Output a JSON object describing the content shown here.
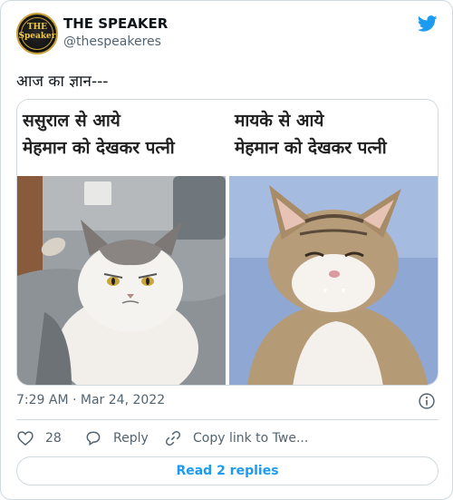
{
  "author": {
    "avatar_text_line1": "THE",
    "avatar_text_line2": "Speaker",
    "name": "THE SPEAKER",
    "handle": "@thespeakeres"
  },
  "tweet": {
    "text": "आज का ज्ञान---",
    "timestamp": "7:29 AM · Mar 24, 2022"
  },
  "media": {
    "left_caption_line1": "ससुराल से आये",
    "left_caption_line2": "मेहमान को देखकर पत्नी",
    "right_caption_line1": "मायके से आये",
    "right_caption_line2": "मेहमान को देखकर पत्नी"
  },
  "actions": {
    "like_count": "28",
    "reply_label": "Reply",
    "copy_link_label": "Copy link to Twe..."
  },
  "read_replies_label": "Read 2 replies",
  "icons": {
    "brand": "twitter-bird-icon",
    "info": "info-icon",
    "like": "heart-icon",
    "reply": "speech-bubble-icon",
    "copy": "link-icon"
  },
  "colors": {
    "accent": "#1d9bf0",
    "text": "#0f1419",
    "secondary": "#536471",
    "border": "#cfd9de",
    "like_red": "#f91880"
  }
}
